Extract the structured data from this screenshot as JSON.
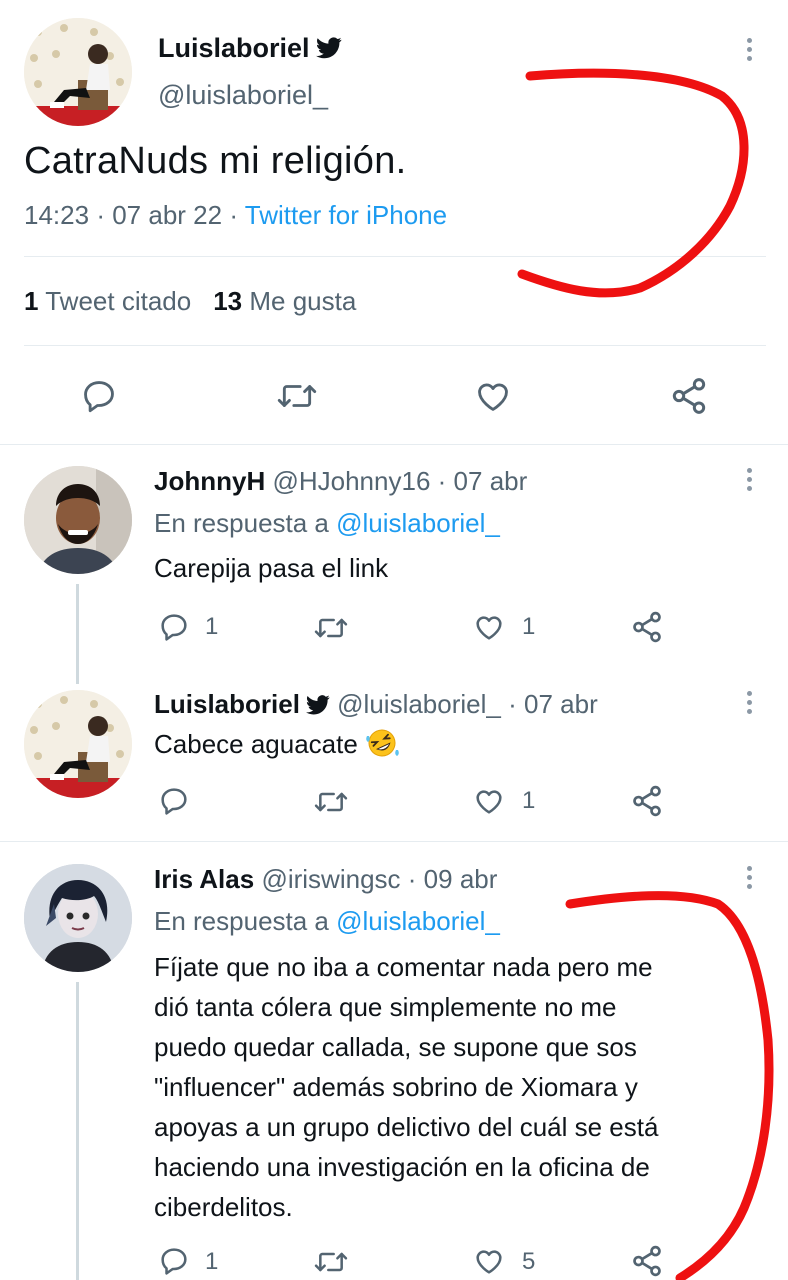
{
  "main_tweet": {
    "author_name": "Luislaboriel",
    "handle": "@luislaboriel_",
    "text": "CatraNuds mi religión.",
    "time": "14:23",
    "date": "07 abr 22",
    "source": "Twitter for iPhone",
    "quote_count": "1",
    "quote_label": "Tweet citado",
    "like_count": "13",
    "like_label": "Me gusta",
    "sep": "·"
  },
  "replies": [
    {
      "author_name": "JohnnyH",
      "handle": "@HJohnny16",
      "date": "07 abr",
      "reply_prefix": "En respuesta a",
      "reply_to": "@luislaboriel_",
      "text": "Carepija pasa el link",
      "reply_count": "1",
      "like_count": "1"
    },
    {
      "author_name": "Luislaboriel",
      "handle": "@luislaboriel_",
      "date": "07 abr",
      "text": "Cabece aguacate",
      "like_count": "1"
    },
    {
      "author_name": "Iris Alas",
      "handle": "@iriswingsc",
      "date": "09 abr",
      "reply_prefix": "En respuesta a",
      "reply_to": "@luislaboriel_",
      "text_lines": [
        "Fíjate que no iba a comentar nada pero me",
        "dió tanta cólera que simplemente no me",
        "puedo quedar callada, se supone que sos",
        "\"influencer\" además sobrino de Xiomara y",
        "apoyas a un grupo delictivo del cuál se está",
        "haciendo una investigación en la oficina de",
        "ciberdelitos."
      ],
      "reply_count": "1",
      "like_count": "5"
    }
  ],
  "colors": {
    "accent": "#1d9bf0",
    "text": "#0f1419",
    "secondary": "#536471",
    "annotation": "#ee1111"
  },
  "icons": {
    "reply": "speech-bubble-icon",
    "retweet": "retweet-icon",
    "like": "heart-icon",
    "share": "share-icon",
    "verified": "twitter-bird-icon",
    "more": "kebab-menu-icon"
  }
}
